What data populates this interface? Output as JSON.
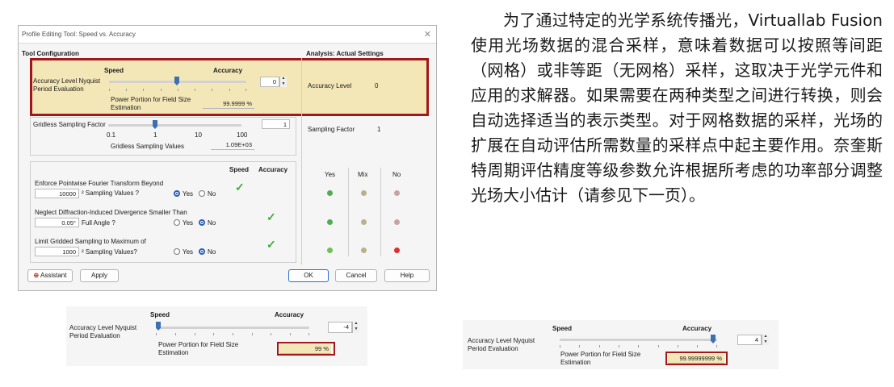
{
  "dialog": {
    "title": "Profile Editing Tool: Speed vs. Accuracy",
    "close_glyph": "✕",
    "tool_configuration": "Tool Configuration",
    "analysis_header": "Analysis: Actual Settings",
    "speed_label": "Speed",
    "accuracy_label": "Accuracy",
    "accuracy_level_label": "Accuracy Level Nyquist Period Evaluation",
    "accuracy_level_value": "0",
    "power_portion_label": "Power Portion for Field Size Estimation",
    "power_portion_value": "99.9999 %",
    "gridless_factor_label": "Gridless Sampling Factor",
    "gridless_factor_value": "1",
    "gridless_ticks": [
      "0.1",
      "1",
      "10",
      "100"
    ],
    "gridless_values_label": "Gridless Sampling Values",
    "gridless_values_value": "1.09E+03",
    "analysis_accuracy_level_label": "Accuracy Level",
    "analysis_accuracy_level_value": "0",
    "analysis_sampling_factor_label": "Sampling Factor",
    "analysis_sampling_factor_value": "1",
    "col_speed": "Speed",
    "col_accuracy": "Accuracy",
    "col_yes": "Yes",
    "col_mix": "Mix",
    "col_no": "No",
    "rows": [
      {
        "label": "Enforce Pointwise Fourier Transform Beyond",
        "value": "10000",
        "unit": "² Sampling Values ?",
        "yes": "Yes",
        "no": "No",
        "selected": "yes",
        "check_column": "speed"
      },
      {
        "label": "Neglect Diffraction-Induced Divergence Smaller Than",
        "value": "0.05°",
        "unit": "Full Angle ?",
        "yes": "Yes",
        "no": "No",
        "selected": "no",
        "check_column": "accuracy"
      },
      {
        "label": "Limit Gridded Sampling to Maximum of",
        "value": "1000",
        "unit": "² Sampling Values?",
        "yes": "Yes",
        "no": "No",
        "selected": "no",
        "check_column": "accuracy"
      }
    ],
    "check_glyph": "✓",
    "buttons": {
      "assistant": "Assistant",
      "apply": "Apply",
      "ok": "OK",
      "cancel": "Cancel",
      "help": "Help"
    },
    "colors": {
      "highlight": "#f3e7b8",
      "red_border": "#a3171b",
      "green": "#4caf50",
      "gray": "#b8b18e",
      "pink": "#c9a3a3",
      "red": "#d93030",
      "accent": "#3e6fb0"
    }
  },
  "paragraph": "为了通过特定的光学系统传播光，Virtuallab Fusion 使用光场数据的混合采样，意味着数据可以按照等间距（网格）或非等距（无网格）采样，这取决于光学元件和应用的求解器。如果需要在两种类型之间进行转换，则会自动选择适当的表示类型。对于网格数据的采样，光场的扩展在自动评估所需数量的采样点中起主要作用。奈奎斯特周期评估精度等级参数允许根据所考虑的功率部分调整光场大小估计（请参见下一页）。",
  "panel_left": {
    "speed_label": "Speed",
    "accuracy_label": "Accuracy",
    "accuracy_level_label": "Accuracy Level Nyquist Period Evaluation",
    "accuracy_level_value": "-4",
    "power_portion_label": "Power Portion for Field Size Estimation",
    "power_portion_value": "99 %"
  },
  "panel_right": {
    "speed_label": "Speed",
    "accuracy_label": "Accuracy",
    "accuracy_level_label": "Accuracy Level Nyquist Period Evaluation",
    "accuracy_level_value": "4",
    "power_portion_label": "Power Portion for Field Size Estimation",
    "power_portion_value": "99.99999999 %"
  }
}
